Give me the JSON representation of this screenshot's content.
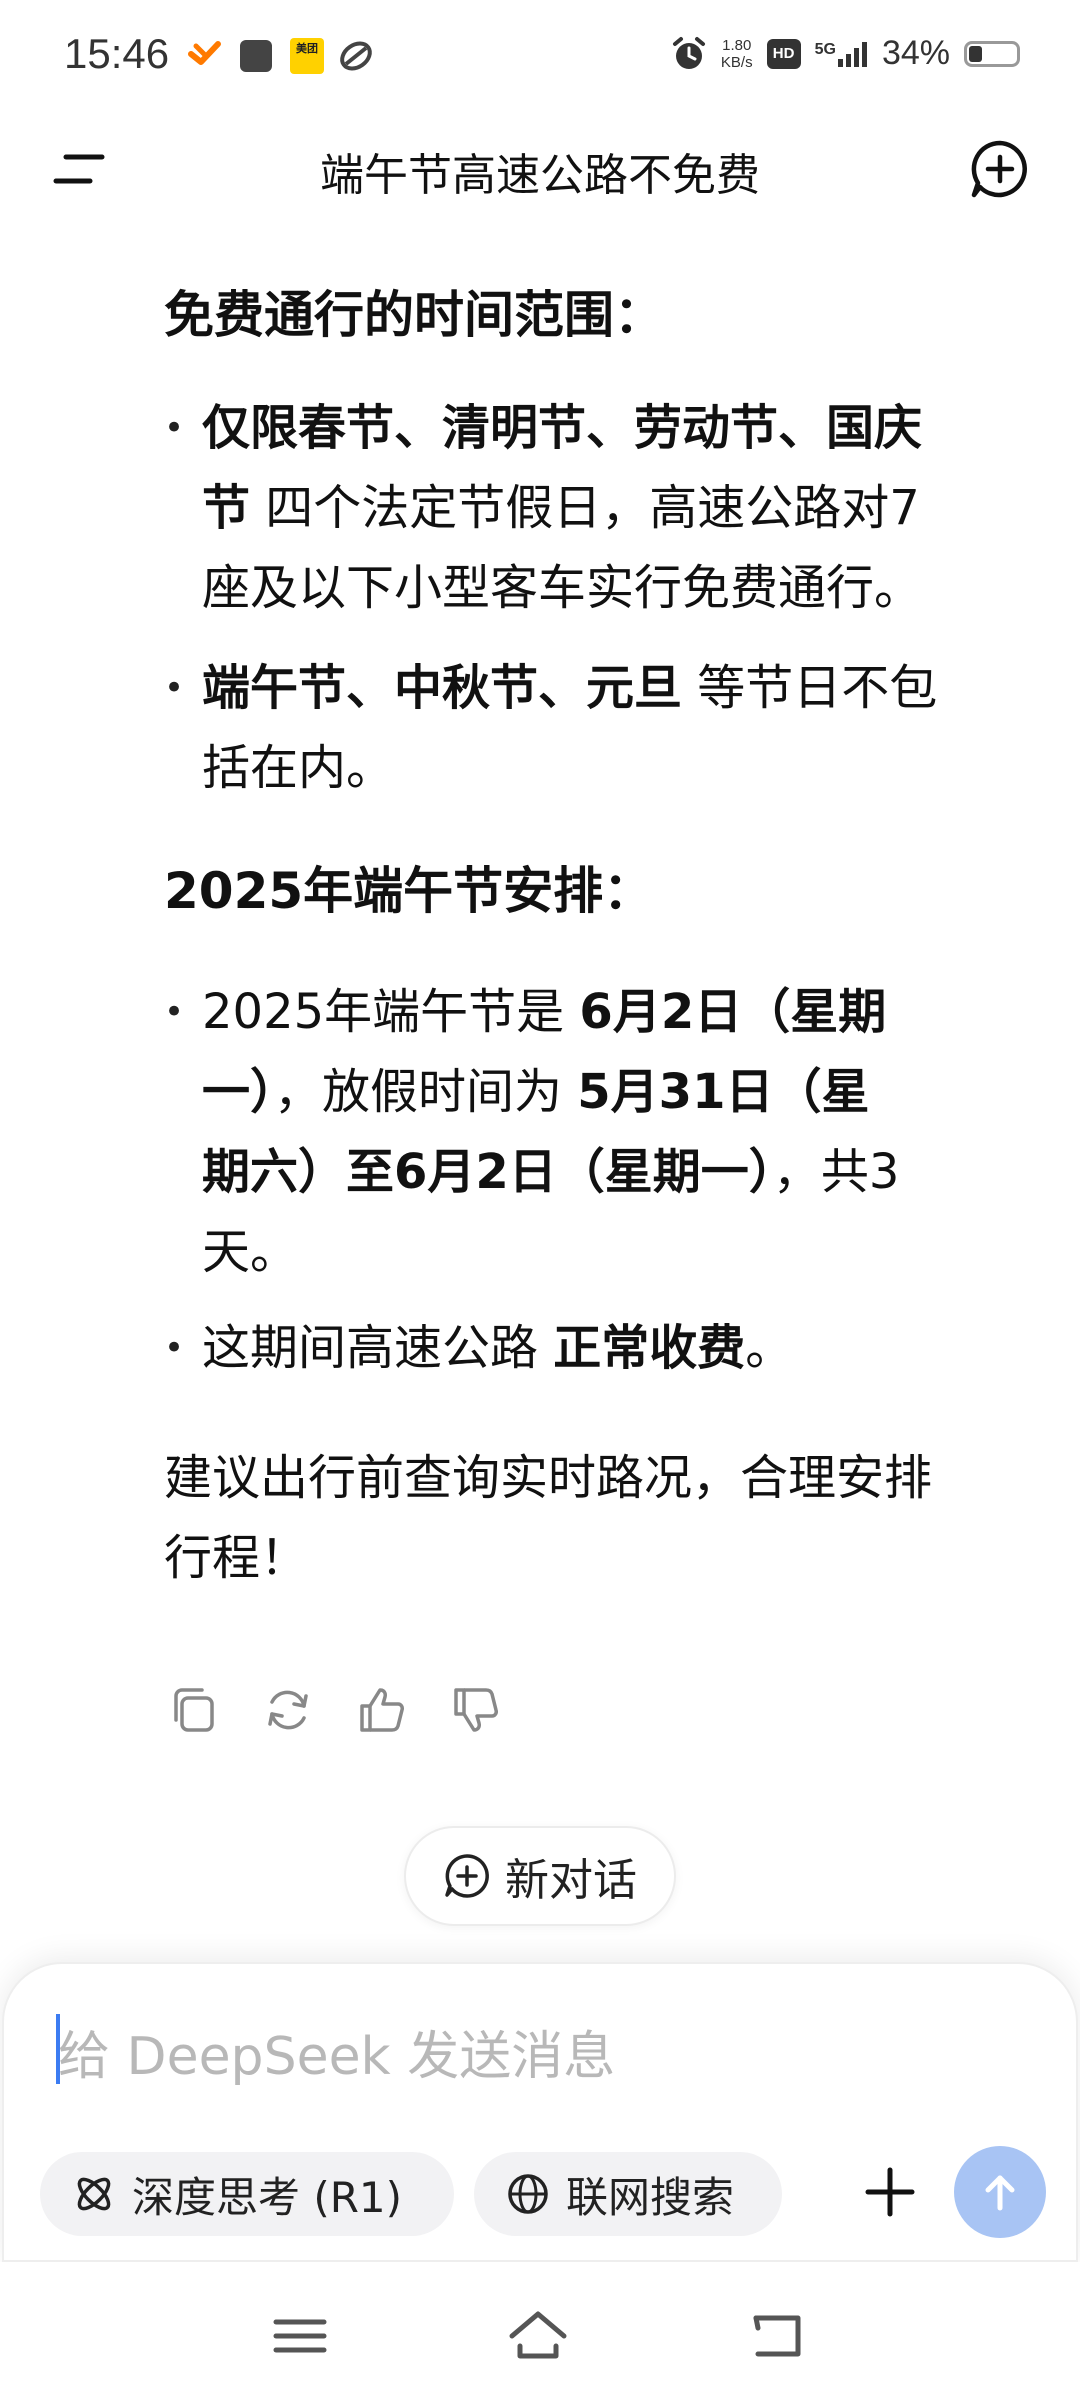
{
  "status_bar": {
    "time": "15:46",
    "net_speed_value": "1.80",
    "net_speed_unit": "KB/s",
    "hd": "HD",
    "signal": "5G",
    "battery_pct": "34%",
    "battery_level": 0.34,
    "icons": [
      "taobao-icon",
      "app-icon",
      "meituan-icon",
      "link-icon",
      "alarm-icon"
    ],
    "meituan_label": "美团"
  },
  "header": {
    "title": "端午节高速公路不免费"
  },
  "content": {
    "section1_title": "免费通行的时间范围：",
    "s1_item1_bold1": "仅限春节、清明节、劳动节、国庆",
    "s1_item1_bold2": "节",
    "s1_item1_text": " 四个法定节假日，高速公路对7",
    "s1_item1_text2": "座及以下小型客车实行免费通行。",
    "s1_item2_bold": "端午节、中秋节、元旦",
    "s1_item2_text": " 等节日不包",
    "s1_item2_text2": "括在内。",
    "section2_title": "2025年端午节安排：",
    "s2_item1_a": "2025年端午节是 ",
    "s2_item1_b": "6月2日（星期",
    "s2_item1_c": "一）",
    "s2_item1_d": "，放假时间为 ",
    "s2_item1_e": "5月31日（星",
    "s2_item1_f": "期六）至6月2日（星期一）",
    "s2_item1_g": "，共3",
    "s2_item1_h": "天。",
    "s2_item2_a": "这期间高速公路 ",
    "s2_item2_b": "正常收费",
    "s2_item2_c": "。",
    "closing_line1": "建议出行前查询实时路况，合理安排",
    "closing_line2": "行程！"
  },
  "actions": [
    "copy-icon",
    "regenerate-icon",
    "thumbs-up-icon",
    "thumbs-down-icon"
  ],
  "new_conversation": "新对话",
  "composer": {
    "placeholder": "给 DeepSeek 发送消息",
    "deep_think": "深度思考 (R1)",
    "web_search": "联网搜索"
  },
  "colors": {
    "accent": "#3c7cf2",
    "send_button": "#a8c4f4",
    "chip_bg": "#f2f2f4",
    "text": "#111111"
  }
}
